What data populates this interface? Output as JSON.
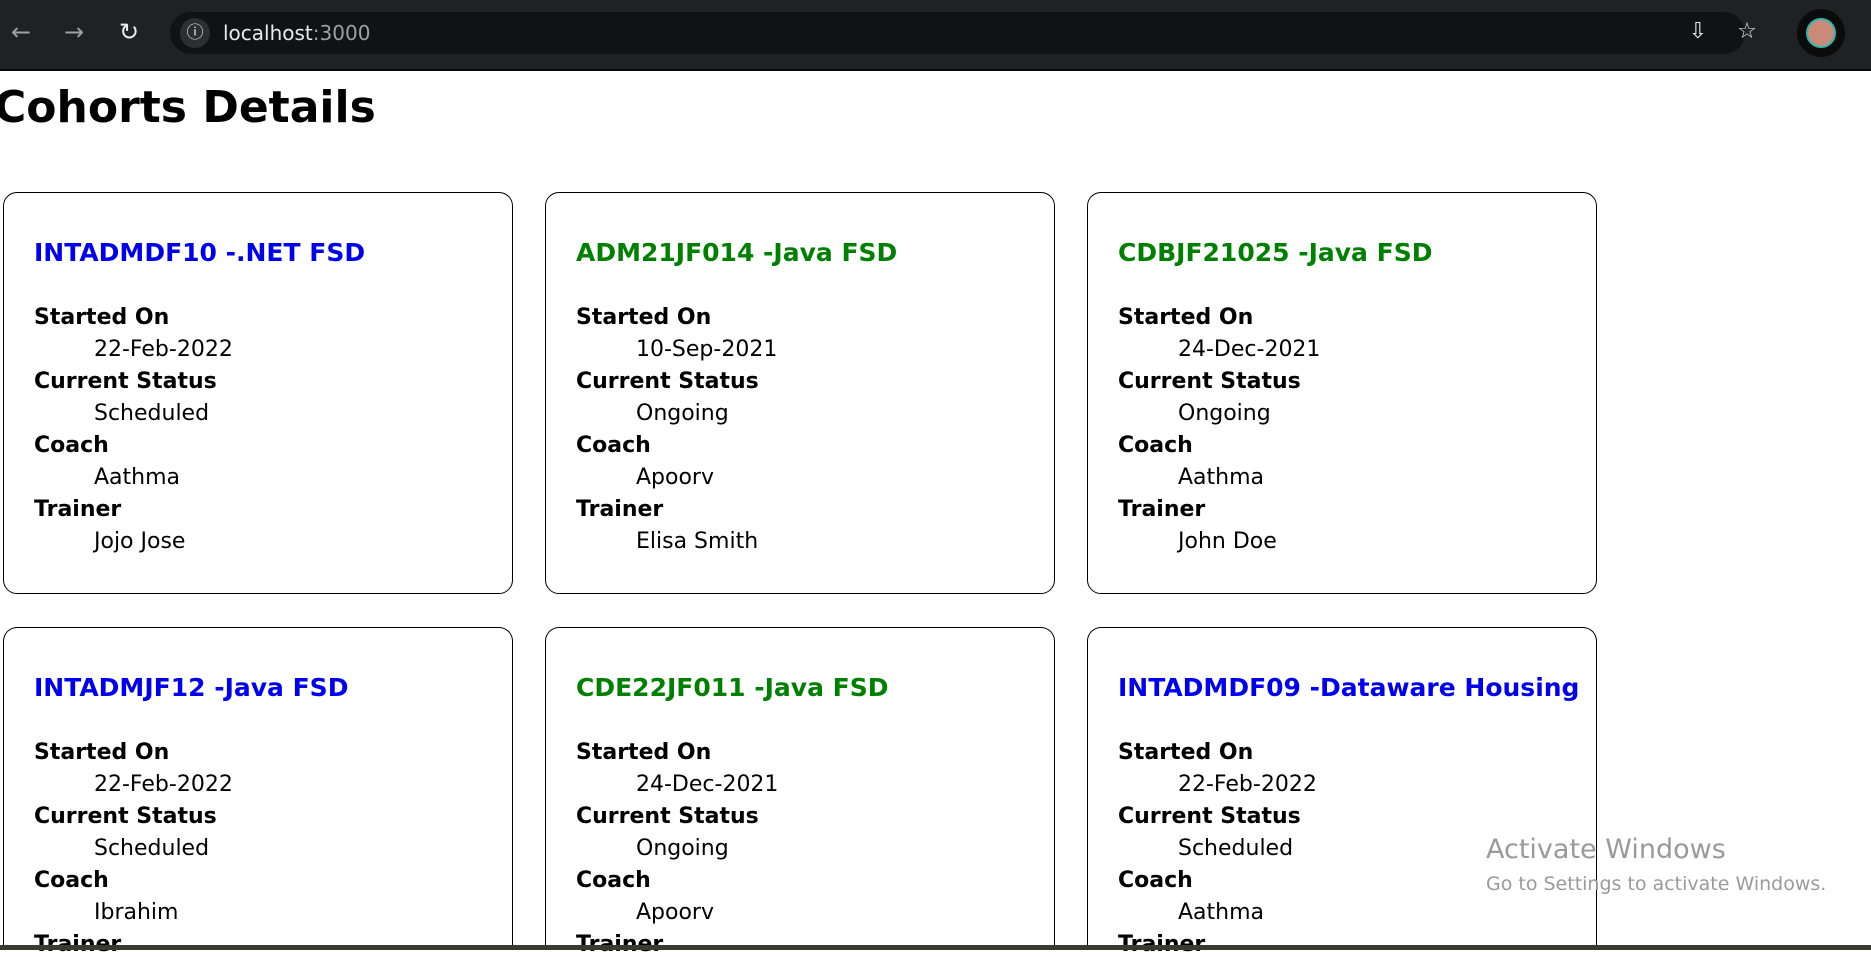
{
  "browser": {
    "url_host": "localhost",
    "url_port": ":3000"
  },
  "page": {
    "title": "Cohorts Details"
  },
  "labels": {
    "started_on": "Started On",
    "current_status": "Current Status",
    "coach": "Coach",
    "trainer": "Trainer"
  },
  "cohorts": [
    {
      "title": "INTADMDF10 -.NET FSD",
      "started_on": "22-Feb-2022",
      "status": "Scheduled",
      "coach": "Aathma",
      "trainer": "Jojo Jose"
    },
    {
      "title": "ADM21JF014 -Java FSD",
      "started_on": "10-Sep-2021",
      "status": "Ongoing",
      "coach": "Apoorv",
      "trainer": "Elisa Smith"
    },
    {
      "title": "CDBJF21025 -Java FSD",
      "started_on": "24-Dec-2021",
      "status": "Ongoing",
      "coach": "Aathma",
      "trainer": "John Doe"
    },
    {
      "title": "INTADMJF12 -Java FSD",
      "started_on": "22-Feb-2022",
      "status": "Scheduled",
      "coach": "Ibrahim",
      "trainer": ""
    },
    {
      "title": "CDE22JF011 -Java FSD",
      "started_on": "24-Dec-2021",
      "status": "Ongoing",
      "coach": "Apoorv",
      "trainer": ""
    },
    {
      "title": "INTADMDF09 -Dataware Housing",
      "started_on": "22-Feb-2022",
      "status": "Scheduled",
      "coach": "Aathma",
      "trainer": ""
    }
  ],
  "colors": {
    "scheduled": "#0000ee",
    "ongoing": "#008000"
  },
  "watermark": {
    "title": "Activate Windows",
    "subtitle": "Go to Settings to activate Windows."
  }
}
